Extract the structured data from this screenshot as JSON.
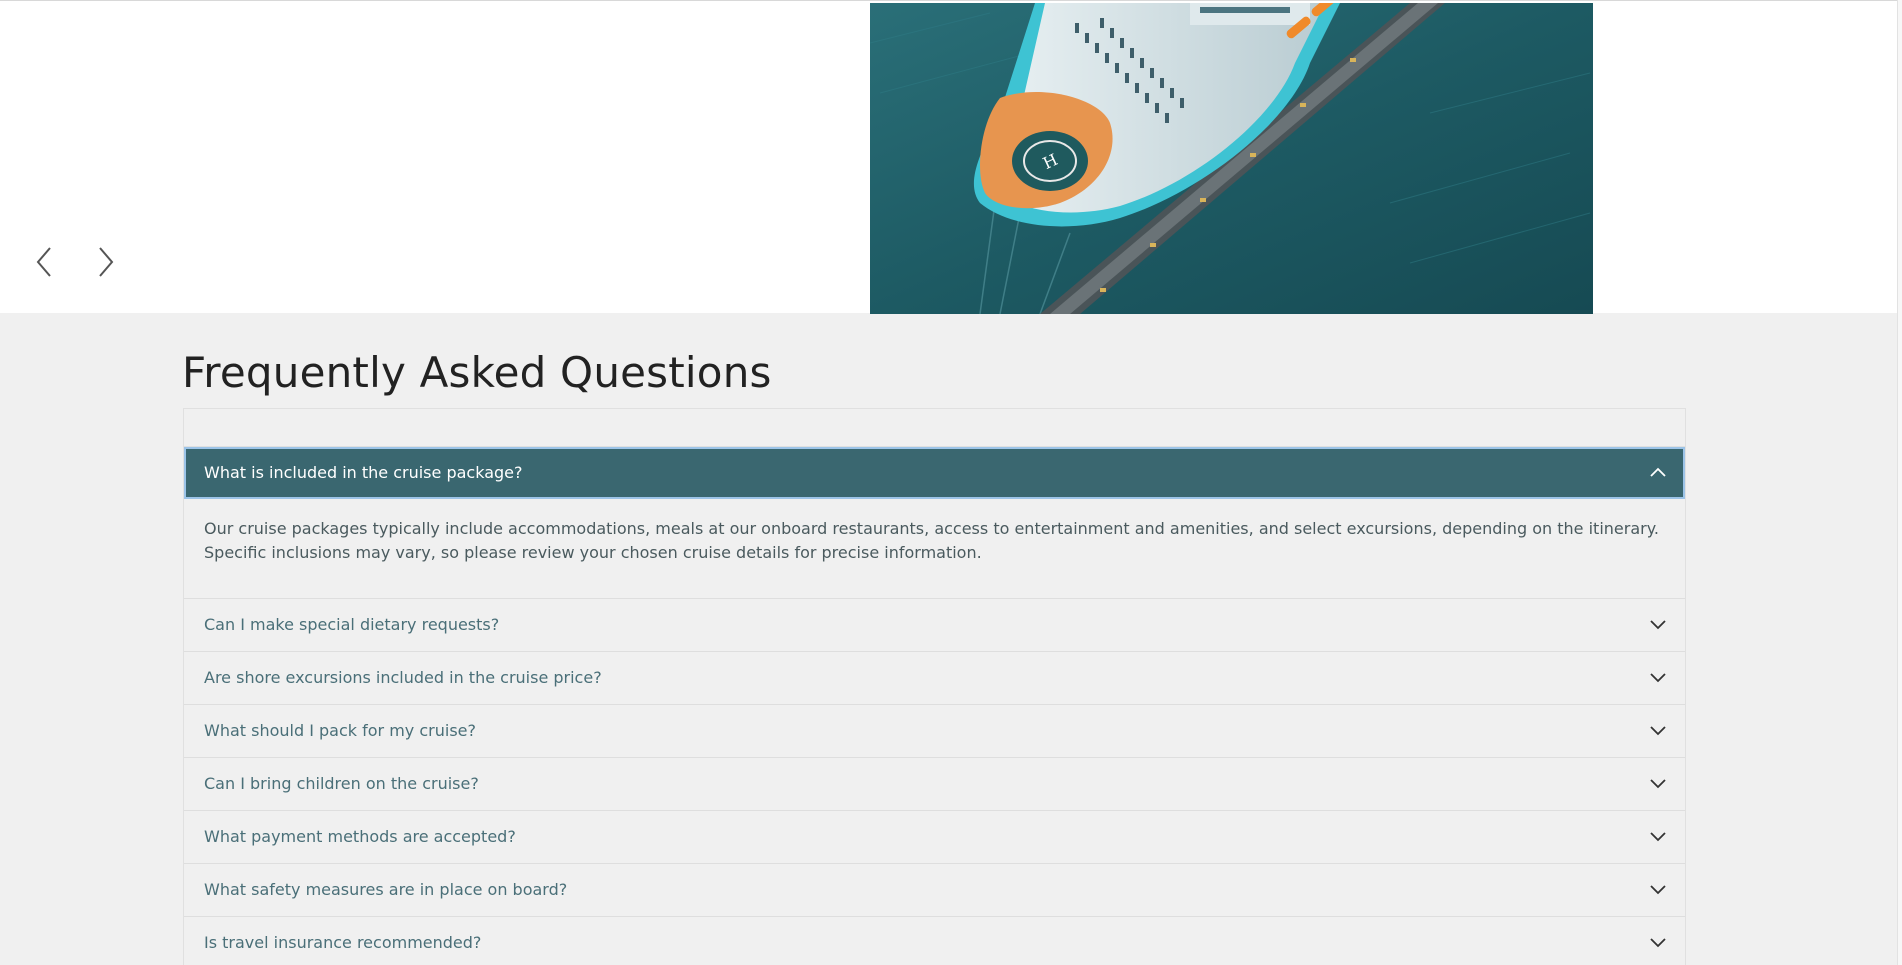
{
  "carousel": {
    "image_alt": "Aerial view of a cruise ship docked at a pier",
    "prev_icon": "chevron-left-icon",
    "next_icon": "chevron-right-icon"
  },
  "faq": {
    "title": "Frequently Asked Questions",
    "items": [
      {
        "question": "What is included in the cruise package?",
        "answer": "Our cruise packages typically include accommodations, meals at our onboard restaurants, access to entertainment and amenities, and select excursions, depending on the itinerary. Specific inclusions may vary, so please review your chosen cruise details for precise information.",
        "expanded": true
      },
      {
        "question": "Can I make special dietary requests?",
        "expanded": false
      },
      {
        "question": "Are shore excursions included in the cruise price?",
        "expanded": false
      },
      {
        "question": "What should I pack for my cruise?",
        "expanded": false
      },
      {
        "question": "Can I bring children on the cruise?",
        "expanded": false
      },
      {
        "question": "What payment methods are accepted?",
        "expanded": false
      },
      {
        "question": "What safety measures are in place on board?",
        "expanded": false
      },
      {
        "question": "Is travel insurance recommended?",
        "expanded": false
      }
    ]
  },
  "colors": {
    "active_header_bg": "#3a6770",
    "question_text": "#4a6f78",
    "page_bg": "#f0f0f0",
    "ocean": "#1d5a63"
  }
}
